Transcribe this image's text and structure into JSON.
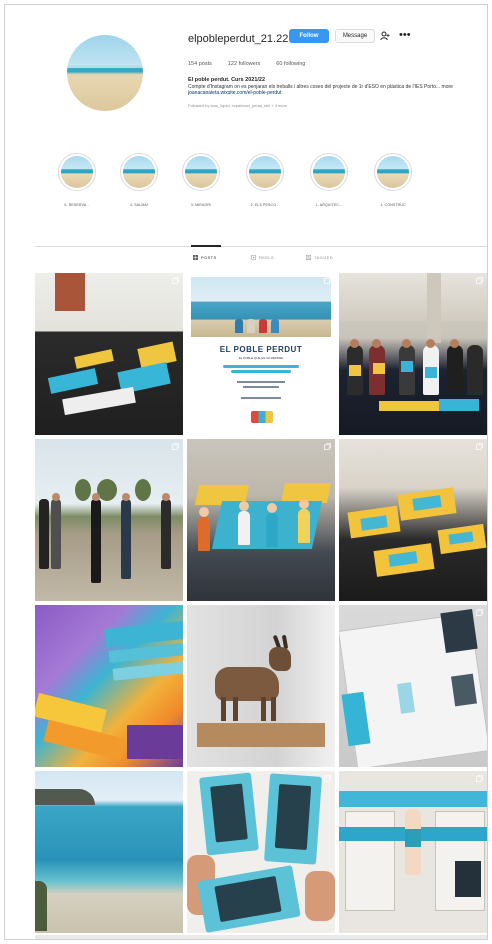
{
  "profile": {
    "username": "elpobleperdut_21.22",
    "follow_label": "Follow",
    "message_label": "Message",
    "stats": {
      "posts": "154 posts",
      "followers": "122 followers",
      "following": "60 following"
    },
    "bio": {
      "name": "El poble perdut. Curs 2021/22",
      "line1": "Compte d'Instagram on es penjaran els treballs i altres coses del projecte de 1r d'ESO en plàstica de l'IES Porto... more",
      "link": "joanacanaleta.wixsite.com/el-poble-perdut",
      "followed_by": "Followed by laoo_liquid, xxpaintaxt_pedal_sell + 4 more"
    }
  },
  "highlights": [
    {
      "label": "5. RESERVA..."
    },
    {
      "label": "4. SALMAI"
    },
    {
      "label": "3. MIRAORI"
    },
    {
      "label": "2. ELS PESCO..."
    },
    {
      "label": "1. ARQUITEC..."
    },
    {
      "label": "1. CONSTRUC"
    }
  ],
  "tabs": [
    {
      "label": "POSTS",
      "active": true
    },
    {
      "label": "REELS",
      "active": false
    },
    {
      "label": "TAGGED",
      "active": false
    }
  ],
  "poster": {
    "title": "EL POBLE PERDUT",
    "subtitle": "EL POBLE QUE ES VA PERDRE"
  },
  "colors": {
    "follow_blue": "#3897f0",
    "accent_cyan": "#39b4d6",
    "accent_yellow": "#f0c640"
  },
  "icons": {
    "more": "more-icon",
    "person": "person-icon",
    "grid": "grid-icon",
    "reels": "reels-icon",
    "tagged": "tagged-icon",
    "multi": "multi-post-icon"
  }
}
